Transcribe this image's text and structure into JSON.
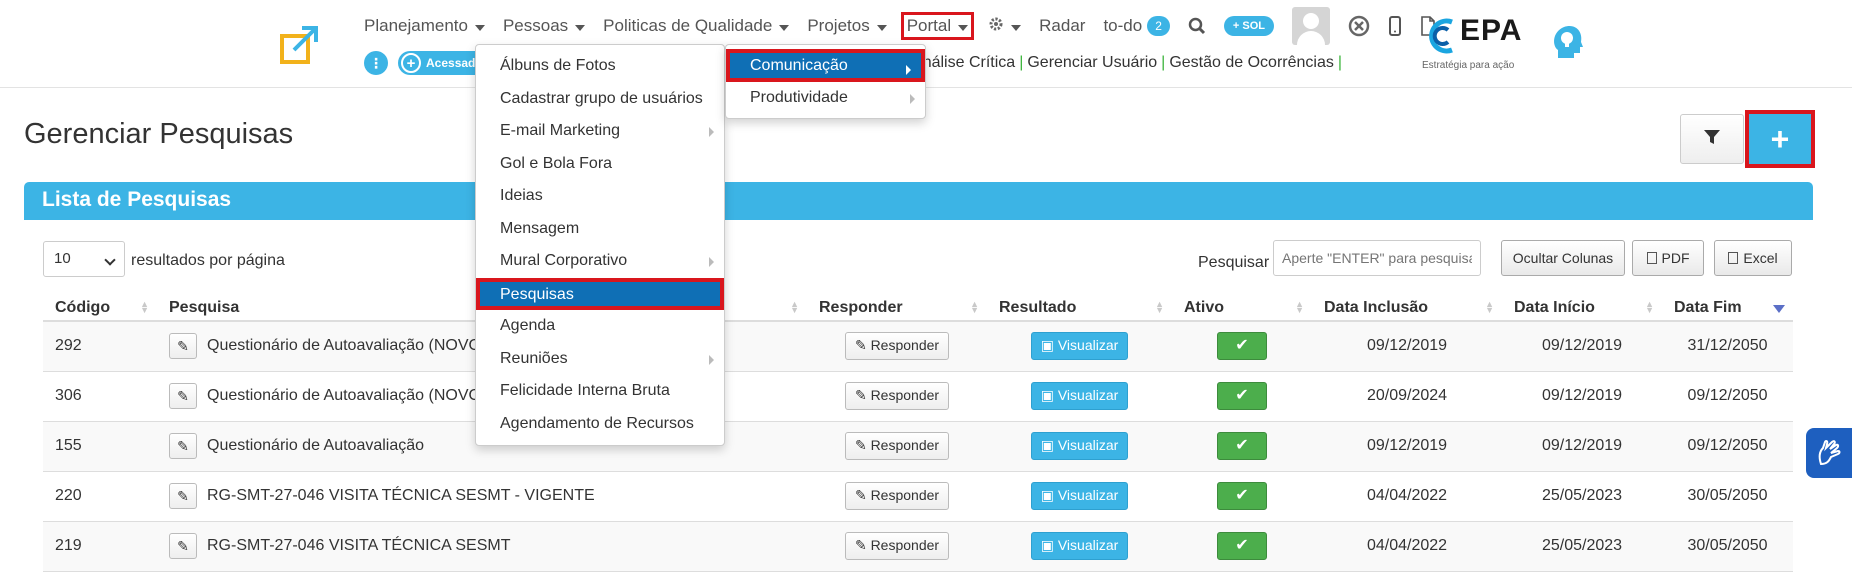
{
  "header": {
    "nav": [
      {
        "label": "Planejamento",
        "caret": true
      },
      {
        "label": "Pessoas",
        "caret": true
      },
      {
        "label": "Politicas de Qualidade",
        "caret": true
      },
      {
        "label": "Projetos",
        "caret": true
      }
    ],
    "portal_label": "Portal",
    "radar_label": "Radar",
    "todo_label": "to-do",
    "todo_count": "2",
    "sol_label": "+ SOL",
    "acessado_label": "Acessado",
    "quick_links": [
      "nálise Crítica",
      "Gerenciar Usuário",
      "Gestão de Ocorrências"
    ],
    "brand_name": "EPA",
    "brand_tagline": "Estratégia para ação"
  },
  "page": {
    "title": "Gerenciar Pesquisas",
    "panel_title": "Lista de Pesquisas",
    "page_length": "10",
    "page_length_label": "resultados por página",
    "search_label": "Pesquisar",
    "search_placeholder": "Aperte \"ENTER\" para pesquisar",
    "hide_columns_label": "Ocultar Colunas",
    "pdf_label": "PDF",
    "excel_label": "Excel"
  },
  "table": {
    "columns": [
      "Código",
      "Pesquisa",
      "Responder",
      "Resultado",
      "Ativo",
      "Data Inclusão",
      "Data Início",
      "Data Fim"
    ],
    "respond_label": "Responder",
    "view_label": "Visualizar",
    "rows": [
      {
        "code": "292",
        "name": "Questionário de Autoavaliação (NOVO)",
        "inclusion": "09/12/2019",
        "start": "09/12/2019",
        "end": "31/12/2050"
      },
      {
        "code": "306",
        "name": "Questionário de Autoavaliação (NOVO)",
        "inclusion": "20/09/2024",
        "start": "09/12/2019",
        "end": "09/12/2050"
      },
      {
        "code": "155",
        "name": "Questionário de Autoavaliação",
        "inclusion": "09/12/2019",
        "start": "09/12/2019",
        "end": "09/12/2050"
      },
      {
        "code": "220",
        "name": "RG-SMT-27-046 VISITA TÉCNICA SESMT - VIGENTE",
        "inclusion": "04/04/2022",
        "start": "25/05/2023",
        "end": "30/05/2050"
      },
      {
        "code": "219",
        "name": "RG-SMT-27-046 VISITA TÉCNICA SESMT",
        "inclusion": "04/04/2022",
        "start": "25/05/2023",
        "end": "30/05/2050"
      }
    ]
  },
  "portal_menu": [
    {
      "label": "Comunicação",
      "submenu": true,
      "active": true
    },
    {
      "label": "Produtividade",
      "submenu": true,
      "active": false
    }
  ],
  "comunicacao_menu": [
    {
      "label": "Álbuns de Fotos",
      "submenu": false
    },
    {
      "label": "Cadastrar grupo de usuários",
      "submenu": false
    },
    {
      "label": "E-mail Marketing",
      "submenu": true
    },
    {
      "label": "Gol e Bola Fora",
      "submenu": false
    },
    {
      "label": "Ideias",
      "submenu": false
    },
    {
      "label": "Mensagem",
      "submenu": false
    },
    {
      "label": "Mural Corporativo",
      "submenu": true
    },
    {
      "label": "Pesquisas",
      "submenu": false,
      "active": true
    },
    {
      "label": "Agenda",
      "submenu": false
    },
    {
      "label": "Reuniões",
      "submenu": true
    },
    {
      "label": "Felicidade Interna Bruta",
      "submenu": false
    },
    {
      "label": "Agendamento de Recursos",
      "submenu": false
    }
  ],
  "colors": {
    "accent": "#3cb4e5",
    "menu_active": "#0f6fb5",
    "highlight_border": "#d9161d",
    "active_green": "#4cae4c",
    "link_separator": "#3cb43c"
  }
}
